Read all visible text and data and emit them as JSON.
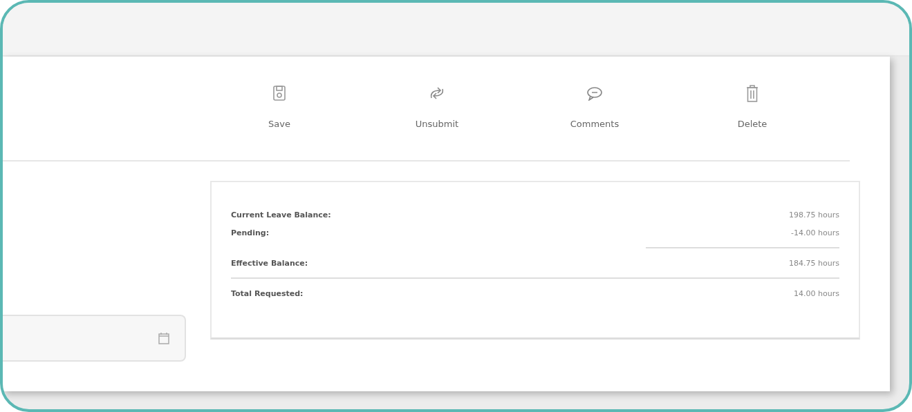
{
  "actions": [
    {
      "label": "Save"
    },
    {
      "label": "Unsubmit"
    },
    {
      "label": "Comments"
    },
    {
      "label": "Delete"
    }
  ],
  "balance": {
    "rows": [
      {
        "kind": "line",
        "label": "Current Leave Balance:",
        "value": "198.75 hours"
      },
      {
        "kind": "line",
        "label": "Pending:",
        "value": "-14.00 hours"
      },
      {
        "kind": "subtotal",
        "label": "Effective Balance:",
        "value": "184.75 hours"
      },
      {
        "kind": "total",
        "label": "Total Requested:",
        "value": "14.00 hours"
      }
    ]
  }
}
